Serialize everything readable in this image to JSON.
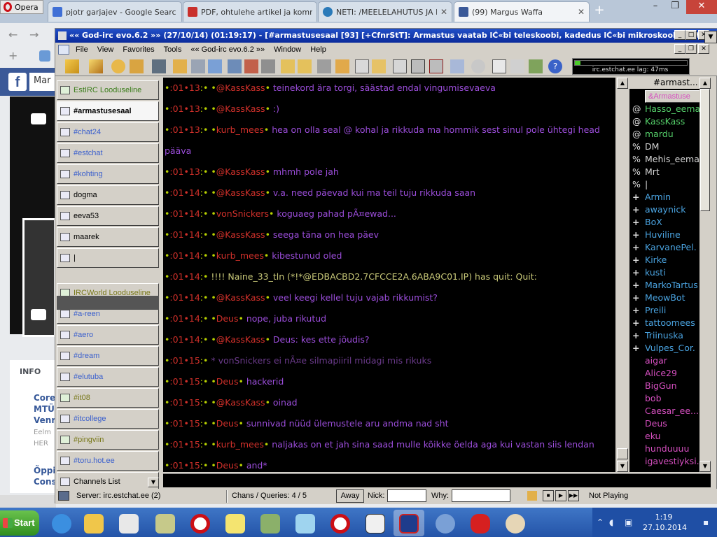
{
  "browser": {
    "opera_label": "Opera",
    "tabs": [
      {
        "label": "pjotr garjajev - Google Searc",
        "color": "#3f6fd6"
      },
      {
        "label": "PDF, ohtulehe artikel ja komm",
        "color": "#c9302c"
      },
      {
        "label": "NETI: /MEELELAHUTUS JA HO",
        "color": "#2a7ab9"
      },
      {
        "label": "(99) Margus Waffa",
        "color": "#3b5998"
      }
    ],
    "mail_badge": "60+"
  },
  "facebook": {
    "logo": "f",
    "search_partial": "Mar",
    "info_heading": "INFO",
    "info_items": [
      {
        "title": "Core MTÜ Venr",
        "sub": "Eelm HER"
      },
      {
        "title": "Õppi Cons",
        "sub": "Varas"
      }
    ]
  },
  "irc": {
    "title": "«« God-irc evo.6.2 »» (27/10/14) (01:19:17) - [#armastusesaal [93] [+CfnrStT]: Armastus vaatab lĆ«bi teleskoobi, kadedus lĆ«bi mikroskoobi. H.W. S...",
    "menu": [
      "File",
      "View",
      "Favorites",
      "Tools",
      "«« God-irc evo.6.2 »»",
      "Window",
      "Help"
    ],
    "lag": {
      "text": "irc.estchat.ee lag: 47ms",
      "level": 0.05
    },
    "channels": [
      {
        "label": "EstIRC Looduseline",
        "kind": "sect"
      },
      {
        "label": "#armastusesaal",
        "kind": "active"
      },
      {
        "label": "#chat24",
        "kind": "msg"
      },
      {
        "label": "#estchat",
        "kind": "msg"
      },
      {
        "label": "#kohting",
        "kind": "msg"
      },
      {
        "label": "dogma",
        "kind": "plain"
      },
      {
        "label": "eeva53",
        "kind": "plain"
      },
      {
        "label": "maarek",
        "kind": "plain"
      },
      {
        "label": "|",
        "kind": "plain"
      },
      {
        "label": "IRCWorld Looduseline",
        "kind": "olive"
      },
      {
        "label": "#a-reen",
        "kind": "msg"
      },
      {
        "label": "#aero",
        "kind": "msg"
      },
      {
        "label": "#dream",
        "kind": "msg"
      },
      {
        "label": "#elutuba",
        "kind": "msg"
      },
      {
        "label": "#it08",
        "kind": "olive"
      },
      {
        "label": "#itcollege",
        "kind": "msg"
      },
      {
        "label": "#pingviin",
        "kind": "olive"
      },
      {
        "label": "#toru.hot.ee",
        "kind": "msg"
      },
      {
        "label": "Channels List",
        "kind": "plain"
      }
    ],
    "messages": [
      {
        "time": "01•13",
        "nick": "@KassKass",
        "text": "teinekord ära torgi, säästad endal vingumisevaeva"
      },
      {
        "time": "01•13",
        "nick": "@KassKass",
        "text": ":)"
      },
      {
        "time": "01•13",
        "nick": "kurb_mees",
        "text": "hea on olla seal @ kohal ja rikkuda ma hommik sest sinul pole ühtegi head päävа"
      },
      {
        "time": "01•13",
        "nick": "@KassKass",
        "text": "mhmh pole jah"
      },
      {
        "time": "01•14",
        "nick": "@KassKass",
        "text": "v.a. need päevad kui ma teil tuju rikkuda saan"
      },
      {
        "time": "01•14",
        "nick": "vonSnickers",
        "text": "koguaeg pahad pÃ¤ewad..."
      },
      {
        "time": "01•14",
        "nick": "@KassKass",
        "text": "seega täna on hea päev"
      },
      {
        "time": "01•14",
        "nick": "kurb_mees",
        "text": "kibestunud oled"
      },
      {
        "time": "01•14",
        "quit": "!!!! Naine_33_tln (*!*@EDBACBD2.7CFCCE2A.6ABA9C01.IP) has quit: Quit:"
      },
      {
        "time": "01•14",
        "nick": "@KassKass",
        "text": "veel keegi kellel tuju vajab rikkumist?"
      },
      {
        "time": "01•14",
        "nick": "Deus",
        "text": "nope, juba rikutud"
      },
      {
        "time": "01•14",
        "nick": "@KassKass",
        "text": "Deus: kes ette jõudis?"
      },
      {
        "time": "01•15",
        "action": "* vonSnickers ei nÃ¤e silmapiiril midagi mis rikuks"
      },
      {
        "time": "01•15",
        "nick": "Deus",
        "text": "hackerid"
      },
      {
        "time": "01•15",
        "nick": "@KassKass",
        "text": "oinad"
      },
      {
        "time": "01•15",
        "nick": "Deus",
        "text": "sunnivad nüüd ülemustele aru andma nad sht"
      },
      {
        "time": "01•15",
        "nick": "kurb_mees",
        "text": "naljakas on et jah sina saad mulle kõikke öelda aga kui vastan siis lendan"
      },
      {
        "time": "01•15",
        "nick": "Deus",
        "text": "and*"
      }
    ],
    "nick_header": "#armast...",
    "nicks": [
      {
        "p": "",
        "n": "&Armastuse",
        "k": "chan"
      },
      {
        "p": "@",
        "n": "Hasso_eema",
        "k": "op"
      },
      {
        "p": "@",
        "n": "KassKass",
        "k": "op"
      },
      {
        "p": "@",
        "n": "mardu",
        "k": "op"
      },
      {
        "p": "%",
        "n": "DM",
        "k": "hop"
      },
      {
        "p": "%",
        "n": "Mehis_eema",
        "k": "hop"
      },
      {
        "p": "%",
        "n": "Mrt",
        "k": "hop"
      },
      {
        "p": "%",
        "n": "|",
        "k": "hop"
      },
      {
        "p": "+",
        "n": "Armin",
        "k": "vo"
      },
      {
        "p": "+",
        "n": "awaynick",
        "k": "vo"
      },
      {
        "p": "+",
        "n": "BoX",
        "k": "vo"
      },
      {
        "p": "+",
        "n": "Huviline",
        "k": "vo"
      },
      {
        "p": "+",
        "n": "KarvanePel.",
        "k": "vo"
      },
      {
        "p": "+",
        "n": "Kirke",
        "k": "vo"
      },
      {
        "p": "+",
        "n": "kusti",
        "k": "vo"
      },
      {
        "p": "+",
        "n": "MarkoTartus",
        "k": "vo"
      },
      {
        "p": "+",
        "n": "MeowBot",
        "k": "vo"
      },
      {
        "p": "+",
        "n": "Preili",
        "k": "vo"
      },
      {
        "p": "+",
        "n": "tattoomees",
        "k": "vo"
      },
      {
        "p": "+",
        "n": "Triinuska",
        "k": "vo"
      },
      {
        "p": "+",
        "n": "Vulpes_Cor.",
        "k": "vo"
      },
      {
        "p": "",
        "n": "aigar",
        "k": "reg"
      },
      {
        "p": "",
        "n": "Alice29",
        "k": "reg"
      },
      {
        "p": "",
        "n": "BigGun",
        "k": "reg"
      },
      {
        "p": "",
        "n": "bob",
        "k": "reg"
      },
      {
        "p": "",
        "n": "Caesar_ee...",
        "k": "reg"
      },
      {
        "p": "",
        "n": "Deus",
        "k": "reg"
      },
      {
        "p": "",
        "n": "eku",
        "k": "reg"
      },
      {
        "p": "",
        "n": "hunduuuu",
        "k": "reg"
      },
      {
        "p": "",
        "n": "igavestiyksi...",
        "k": "reg"
      }
    ],
    "status": {
      "server": "Server: irc.estchat.ee (2)",
      "chans": "Chans / Queries: 4 / 5",
      "away": "Away",
      "nick_label": "Nick:",
      "why_label": "Why:",
      "player": "Not Playing"
    }
  },
  "taskbar": {
    "start": "Start",
    "time": "1:19",
    "date": "27.10.2014"
  }
}
